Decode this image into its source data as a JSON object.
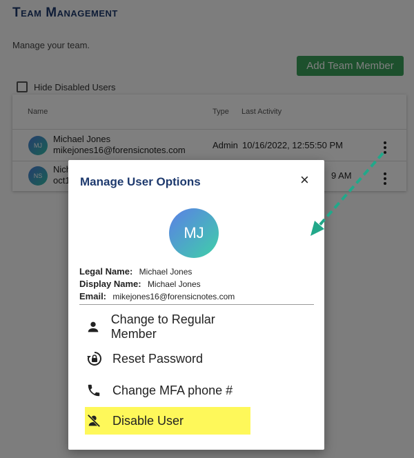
{
  "page": {
    "title": "Team Management",
    "subtitle": "Manage your team.",
    "add_button": "Add Team Member",
    "hide_disabled_label": "Hide Disabled Users"
  },
  "table": {
    "headers": {
      "name": "Name",
      "type": "Type",
      "last_activity": "Last Activity"
    },
    "rows": [
      {
        "initials": "MJ",
        "name": "Michael Jones",
        "email": "mikejones16@forensicnotes.com",
        "type": "Admin",
        "last_activity": "10/16/2022, 12:55:50 PM"
      },
      {
        "initials": "NS",
        "name": "Nich",
        "email": "oct1",
        "type": "",
        "last_activity": "9 AM"
      }
    ]
  },
  "modal": {
    "title": "Manage User Options",
    "close_label": "×",
    "avatar_initials": "MJ",
    "legal_name_label": "Legal Name:",
    "legal_name": "Michael Jones",
    "display_name_label": "Display Name:",
    "display_name": "Michael Jones",
    "email_label": "Email:",
    "email": "mikejones16@forensicnotes.com",
    "options": [
      {
        "label": "Change to Regular Member",
        "icon": "person-icon"
      },
      {
        "label": "Reset Password",
        "icon": "lock-reset-icon"
      },
      {
        "label": "Change MFA phone #",
        "icon": "phone-icon"
      },
      {
        "label": "Disable User",
        "icon": "person-off-icon",
        "highlighted": true
      }
    ]
  },
  "colors": {
    "title": "#1e3a6e",
    "add_button": "#3aa05a",
    "highlight": "#fef85a",
    "arrow": "#22a88a"
  }
}
